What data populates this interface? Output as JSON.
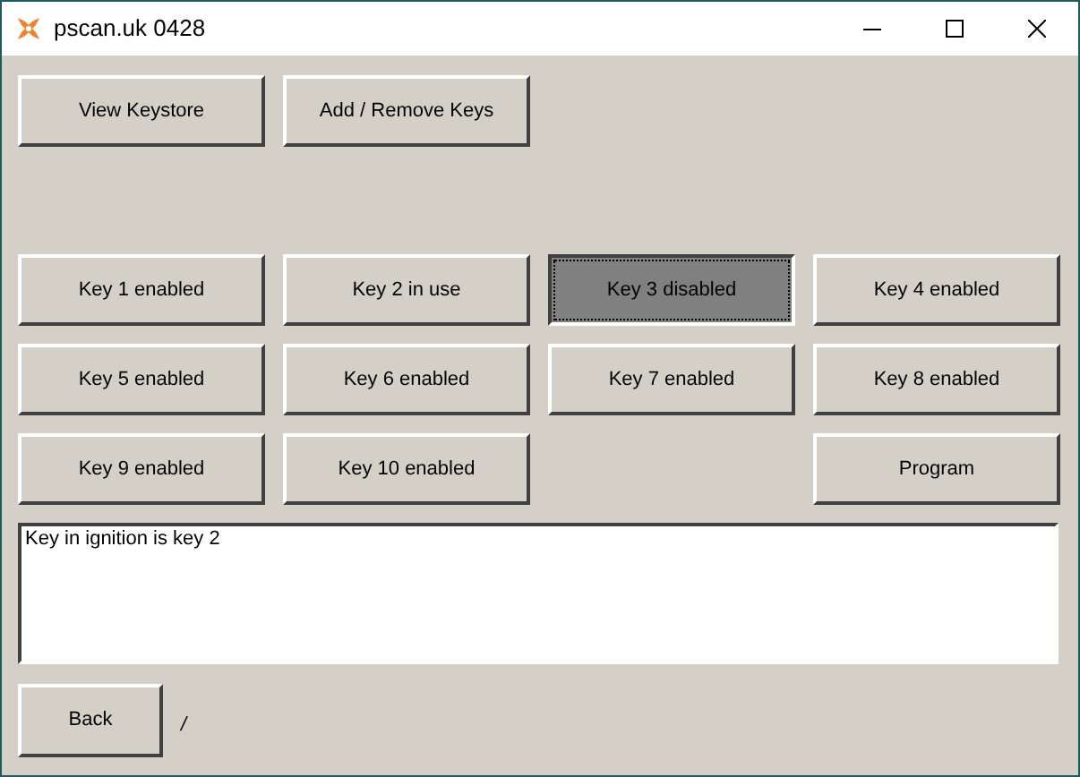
{
  "window": {
    "title": "pscan.uk 0428"
  },
  "top_buttons": [
    {
      "label": "View Keystore"
    },
    {
      "label": "Add / Remove Keys"
    }
  ],
  "key_buttons": [
    {
      "kind": "key",
      "label": "Key 1 enabled",
      "pressed": false
    },
    {
      "kind": "key",
      "label": "Key 2 in use",
      "pressed": false
    },
    {
      "kind": "key",
      "label": "Key 3 disabled",
      "pressed": true
    },
    {
      "kind": "key",
      "label": "Key 4 enabled",
      "pressed": false
    },
    {
      "kind": "key",
      "label": "Key 5 enabled",
      "pressed": false
    },
    {
      "kind": "key",
      "label": "Key 6 enabled",
      "pressed": false
    },
    {
      "kind": "key",
      "label": "Key 7 enabled",
      "pressed": false
    },
    {
      "kind": "key",
      "label": "Key 8 enabled",
      "pressed": false
    },
    {
      "kind": "key",
      "label": "Key 9 enabled",
      "pressed": false
    },
    {
      "kind": "key",
      "label": "Key 10 enabled",
      "pressed": false
    },
    {
      "kind": "program",
      "label": "Program",
      "pressed": false
    }
  ],
  "output": {
    "value": "Key in ignition is key 2"
  },
  "back_button": {
    "label": "Back"
  },
  "status_text": "/"
}
